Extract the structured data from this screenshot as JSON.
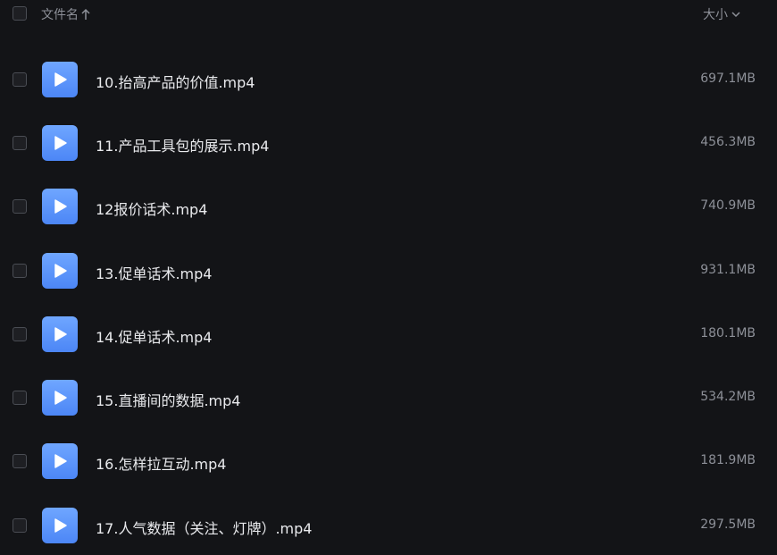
{
  "header": {
    "name_label": "文件名",
    "size_label": "大小",
    "sort_icon": "arrow-up-icon",
    "size_icon": "chevron-down-icon"
  },
  "files": [
    {
      "name": "10.抬高产品的价值.mp4",
      "size": "697.1MB",
      "icon": "video-play-icon"
    },
    {
      "name": "11.产品工具包的展示.mp4",
      "size": "456.3MB",
      "icon": "video-play-icon"
    },
    {
      "name": "12报价话术.mp4",
      "size": "740.9MB",
      "icon": "video-play-icon"
    },
    {
      "name": "13.促单话术.mp4",
      "size": "931.1MB",
      "icon": "video-play-icon"
    },
    {
      "name": "14.促单话术.mp4",
      "size": "180.1MB",
      "icon": "video-play-icon"
    },
    {
      "name": "15.直播间的数据.mp4",
      "size": "534.2MB",
      "icon": "video-play-icon"
    },
    {
      "name": "16.怎样拉互动.mp4",
      "size": "181.9MB",
      "icon": "video-play-icon"
    },
    {
      "name": "17.人气数据（关注、灯牌）.mp4",
      "size": "297.5MB",
      "icon": "video-play-icon"
    }
  ],
  "colors": {
    "background": "#131417",
    "icon_blue": "#5b93fb",
    "text_primary": "#e9eaed",
    "text_secondary": "#8d9098"
  }
}
